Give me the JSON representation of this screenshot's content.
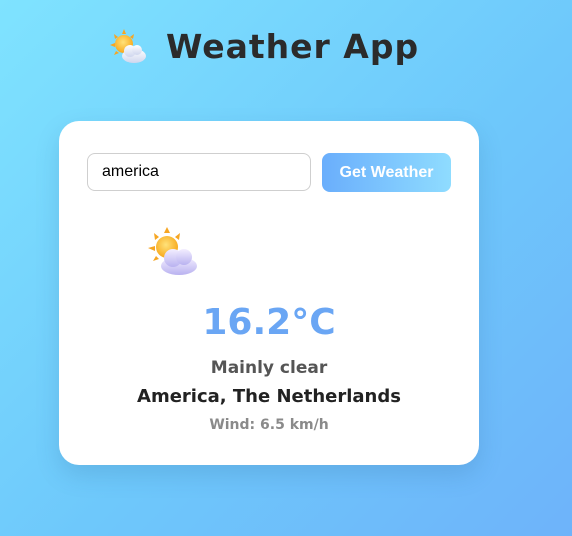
{
  "header": {
    "title": "Weather App",
    "icon": "sun-behind-cloud-icon"
  },
  "search": {
    "value": "america",
    "button_label": "Get Weather"
  },
  "weather": {
    "icon": "sun-behind-cloud-icon",
    "temperature": "16.2°C",
    "condition": "Mainly clear",
    "location": "America, The Netherlands",
    "wind": "Wind: 6.5 km/h"
  },
  "colors": {
    "accent": "#6aa6f4",
    "button_start": "#6aaefc",
    "button_end": "#8fdcff",
    "background_start": "#7fe3ff",
    "background_end": "#6eb3fa"
  }
}
